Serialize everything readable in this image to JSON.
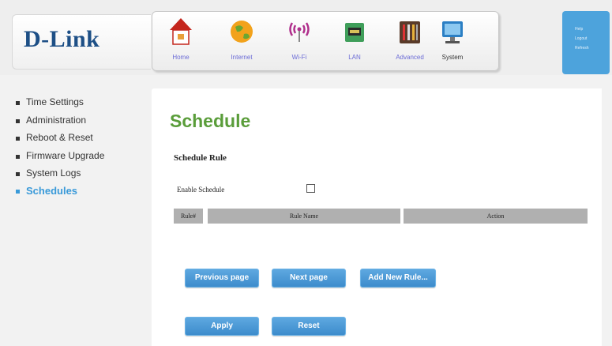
{
  "brand": {
    "logo": "D-Link"
  },
  "nav": [
    {
      "label": "Home",
      "icon": "home-icon"
    },
    {
      "label": "Internet",
      "icon": "globe-icon"
    },
    {
      "label": "Wi-Fi",
      "icon": "wifi-icon"
    },
    {
      "label": "LAN",
      "icon": "lan-icon"
    },
    {
      "label": "Advanced",
      "icon": "tools-icon"
    },
    {
      "label": "System",
      "icon": "computer-icon"
    }
  ],
  "top_links": {
    "help": "Help",
    "logout": "Logout",
    "refresh": "Refresh"
  },
  "sidebar": {
    "items": [
      {
        "label": "Time Settings"
      },
      {
        "label": "Administration"
      },
      {
        "label": "Reboot & Reset"
      },
      {
        "label": "Firmware Upgrade"
      },
      {
        "label": "System Logs"
      },
      {
        "label": "Schedules"
      }
    ],
    "active_index": 5
  },
  "page": {
    "title": "Schedule",
    "section_title": "Schedule Rule",
    "enable_label": "Enable Schedule",
    "enable_checked": false
  },
  "table": {
    "headers": [
      "Rule#",
      "Rule Name",
      "Action"
    ]
  },
  "buttons": {
    "previous_page": "Previous page",
    "next_page": "Next page",
    "add_new_rule": "Add New Rule...",
    "apply": "Apply",
    "reset": "Reset"
  },
  "colors": {
    "accent_blue": "#3a9ad9",
    "title_green": "#5a9d3a",
    "logo_navy": "#1d4f86",
    "button_blue": "#4a98d6"
  }
}
